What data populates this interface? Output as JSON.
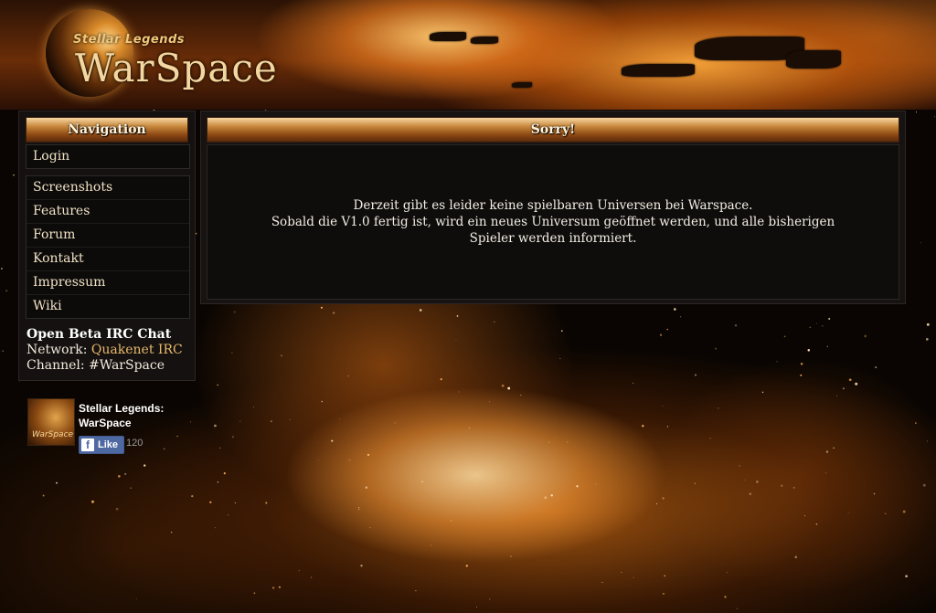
{
  "brand": {
    "tagline": "Stellar Legends",
    "name": "WarSpace"
  },
  "navigation": {
    "title": "Navigation",
    "login": "Login",
    "items": [
      "Screenshots",
      "Features",
      "Forum",
      "Kontakt",
      "Impressum",
      "Wiki"
    ]
  },
  "irc": {
    "title": "Open Beta IRC Chat",
    "network_label": "Network:",
    "network_link": "Quakenet IRC",
    "channel_label": "Channel:",
    "channel_value": "#WarSpace"
  },
  "facebook": {
    "page_name": "Stellar Legends: WarSpace",
    "like_label": "Like",
    "like_count": "120",
    "icon": "facebook-f-icon"
  },
  "main": {
    "title": "Sorry!",
    "line1": "Derzeit gibt es leider keine spielbaren Universen bei Warspace.",
    "line2": "Sobald die V1.0 fertig ist, wird ein neues Universum geöffnet werden, und alle bisherigen",
    "line3": "Spieler werden informiert."
  },
  "colors": {
    "accent_gold": "#c98a3e",
    "link": "#e8b96a",
    "panel_bg": "#141110",
    "facebook_blue": "#4e69a2"
  }
}
